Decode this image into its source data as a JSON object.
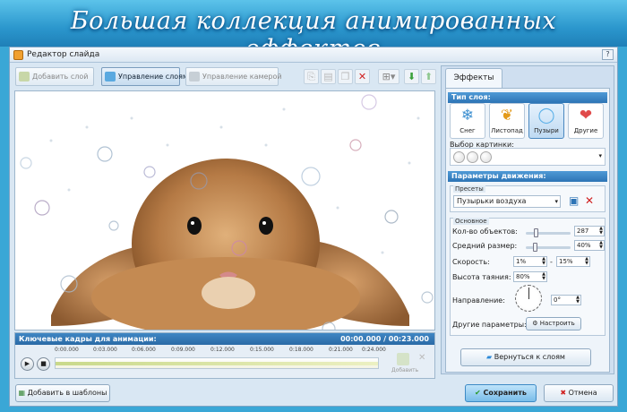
{
  "banner": {
    "title": "Большая коллекция анимированных эффектов"
  },
  "window": {
    "title": "Редактор слайда",
    "help": "?"
  },
  "toolbar": {
    "add_layer": "Добавить слой",
    "manage_layers": "Управление слоями",
    "manage_camera": "Управление камерой"
  },
  "keyframes": {
    "title": "Ключевые кадры для анимации:",
    "time": "00:00.000 / 00:23.000",
    "ticks": [
      "0:00.000",
      "0:03.000",
      "0:06.000",
      "0:09.000",
      "0:12.000",
      "0:15.000",
      "0:18.000",
      "0:21.000",
      "0:24.000"
    ],
    "add_label": "Добавить"
  },
  "panel": {
    "tab": "Эффекты",
    "layer_type_title": "Тип слоя:",
    "types": [
      {
        "label": "Снег",
        "icon": "snowflake-icon"
      },
      {
        "label": "Листопад",
        "icon": "leaf-icon"
      },
      {
        "label": "Пузыри",
        "icon": "bubble-icon"
      },
      {
        "label": "Другие",
        "icon": "hearts-icon"
      }
    ],
    "picture_label": "Выбор картинки:",
    "motion_title": "Параметры движения:",
    "presets_caption": "Пресеты",
    "preset_value": "Пузырьки воздуха",
    "basic_caption": "Основное",
    "count_label": "Кол-во объектов:",
    "count_value": "287",
    "size_label": "Средний размер:",
    "size_value": "40%",
    "speed_label": "Скорость:",
    "speed_from": "1%",
    "speed_dash": "-",
    "speed_to": "15%",
    "melt_label": "Высота таяния:",
    "melt_value": "80%",
    "direction_label": "Направление:",
    "direction_value": "0°",
    "other_label": "Другие параметры:",
    "configure": "Настроить",
    "back": "Вернуться к слоям"
  },
  "footer": {
    "add_template": "Добавить в шаблоны",
    "save": "Сохранить",
    "cancel": "Отмена"
  },
  "colors": {
    "accent": "#2d74b5",
    "banner": "#2b97cd",
    "save": "#79bde9"
  }
}
